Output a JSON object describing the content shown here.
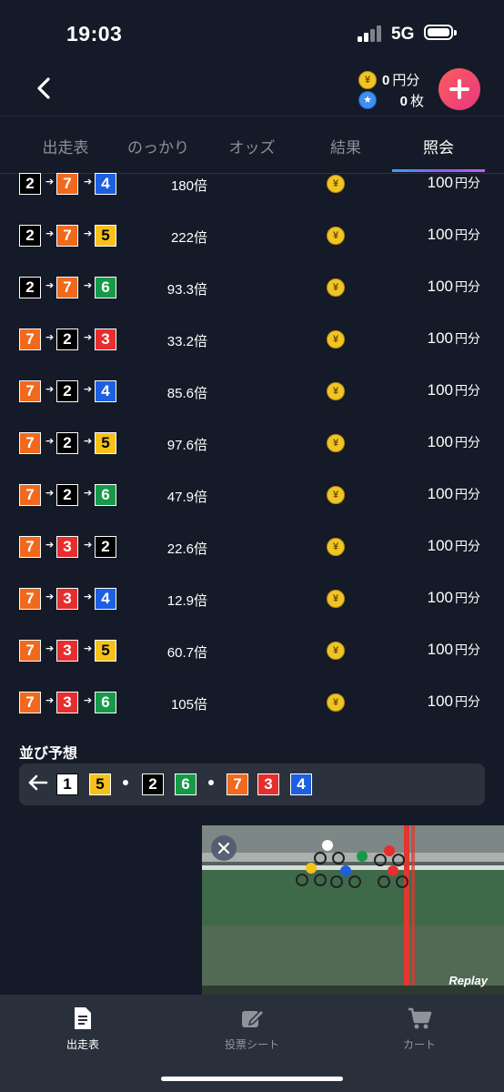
{
  "status": {
    "time": "19:03",
    "network": "5G"
  },
  "header": {
    "balance_yen_value": "0",
    "balance_yen_unit": "円分",
    "balance_ticket_value": "0",
    "balance_ticket_unit": "枚"
  },
  "tabs": [
    {
      "label": "出走表",
      "active": false
    },
    {
      "label": "のっかり",
      "active": false
    },
    {
      "label": "オッズ",
      "active": false
    },
    {
      "label": "結果",
      "active": false
    },
    {
      "label": "照会",
      "active": true
    }
  ],
  "bets": [
    {
      "c": [
        "2",
        "7",
        "4"
      ],
      "odds": "180倍",
      "amount": "100",
      "unit": "円分"
    },
    {
      "c": [
        "2",
        "7",
        "5"
      ],
      "odds": "222倍",
      "amount": "100",
      "unit": "円分"
    },
    {
      "c": [
        "2",
        "7",
        "6"
      ],
      "odds": "93.3倍",
      "amount": "100",
      "unit": "円分"
    },
    {
      "c": [
        "7",
        "2",
        "3"
      ],
      "odds": "33.2倍",
      "amount": "100",
      "unit": "円分"
    },
    {
      "c": [
        "7",
        "2",
        "4"
      ],
      "odds": "85.6倍",
      "amount": "100",
      "unit": "円分"
    },
    {
      "c": [
        "7",
        "2",
        "5"
      ],
      "odds": "97.6倍",
      "amount": "100",
      "unit": "円分"
    },
    {
      "c": [
        "7",
        "2",
        "6"
      ],
      "odds": "47.9倍",
      "amount": "100",
      "unit": "円分"
    },
    {
      "c": [
        "7",
        "3",
        "2"
      ],
      "odds": "22.6倍",
      "amount": "100",
      "unit": "円分"
    },
    {
      "c": [
        "7",
        "3",
        "4"
      ],
      "odds": "12.9倍",
      "amount": "100",
      "unit": "円分"
    },
    {
      "c": [
        "7",
        "3",
        "5"
      ],
      "odds": "60.7倍",
      "amount": "100",
      "unit": "円分"
    },
    {
      "c": [
        "7",
        "3",
        "6"
      ],
      "odds": "105倍",
      "amount": "100",
      "unit": "円分"
    }
  ],
  "line_prediction": {
    "title": "並び予想",
    "numbers": [
      "1",
      "5",
      "2",
      "6",
      "7",
      "3",
      "4"
    ]
  },
  "video": {
    "overlay_text": "Replay"
  },
  "bottom_nav": [
    {
      "label": "出走表",
      "active": true,
      "icon": "document-icon"
    },
    {
      "label": "投票シート",
      "active": false,
      "icon": "edit-sheet-icon"
    },
    {
      "label": "カート",
      "active": false,
      "icon": "cart-icon"
    }
  ],
  "colors": {
    "background": "#141a27",
    "accent_gradient": [
      "#3aa0ff",
      "#c05cff"
    ],
    "plus_button": "#ff4f6d",
    "bike_1": "#ffffff",
    "bike_2": "#000000",
    "bike_3": "#e62e2e",
    "bike_4": "#1d5fe0",
    "bike_5": "#f6c21a",
    "bike_6": "#169a4a",
    "bike_7": "#f0691c"
  }
}
